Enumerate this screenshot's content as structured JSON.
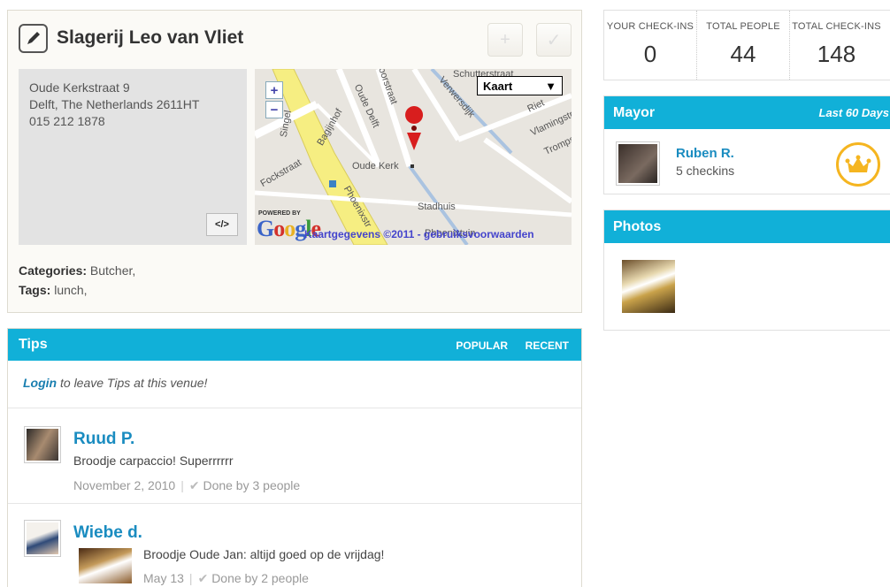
{
  "venue": {
    "name": "Slagerij Leo van Vliet",
    "address_line1": "Oude Kerkstraat 9",
    "address_line2": "Delft, The Netherlands 2611HT",
    "phone": "015 212 1878",
    "embed_label": "</>",
    "categories_label": "Categories:",
    "categories_value": "Butcher,",
    "tags_label": "Tags:",
    "tags_value": "lunch,"
  },
  "map": {
    "type_label": "Kaart",
    "zoom_in": "+",
    "zoom_out": "−",
    "powered_by": "POWERED BY",
    "credits": "Kaartgegevens ©2011 - gebruiksvoorwaarden",
    "labels": {
      "oude_kerk": "Oude Kerk",
      "stadhuis": "Stadhuis",
      "phoenixstr": "Phoenixstr",
      "fockstraat": "Fockstraat",
      "bagijnhof": "Bagijnhof",
      "oude_delft": "Oude Delft",
      "verwersdijk": "Verwersdijk",
      "vlamingstr": "Vlamingstr",
      "voorstraat": "Voorstraat",
      "phoenixtuin": "Phoenixtuin",
      "schutterstraat": "Schutterstraat",
      "singel": "Singel",
      "trompstr": "Trompst",
      "rietveld": "Riet"
    }
  },
  "tips": {
    "title": "Tips",
    "tab_popular": "POPULAR",
    "tab_recent": "RECENT",
    "login_link": "Login",
    "login_text": " to leave Tips at this venue!",
    "items": [
      {
        "user": "Ruud P.",
        "text": "Broodje carpaccio! Superrrrrr",
        "date": "November 2, 2010",
        "done": "Done by 3 people"
      },
      {
        "user": "Wiebe d.",
        "text": "Broodje Oude Jan: altijd goed op de vrijdag!",
        "date": "May 13",
        "done": "Done by 2 people"
      }
    ]
  },
  "stats": [
    {
      "label": "YOUR CHECK-INS",
      "value": "0"
    },
    {
      "label": "TOTAL PEOPLE",
      "value": "44"
    },
    {
      "label": "TOTAL CHECK-INS",
      "value": "148"
    }
  ],
  "mayor": {
    "title": "Mayor",
    "period": "Last 60 Days",
    "name": "Ruben R.",
    "checkins": "5 checkins"
  },
  "photos": {
    "title": "Photos"
  },
  "colors": {
    "accent": "#11b0d8",
    "link": "#1a8cc0",
    "crown": "#f5b520"
  }
}
